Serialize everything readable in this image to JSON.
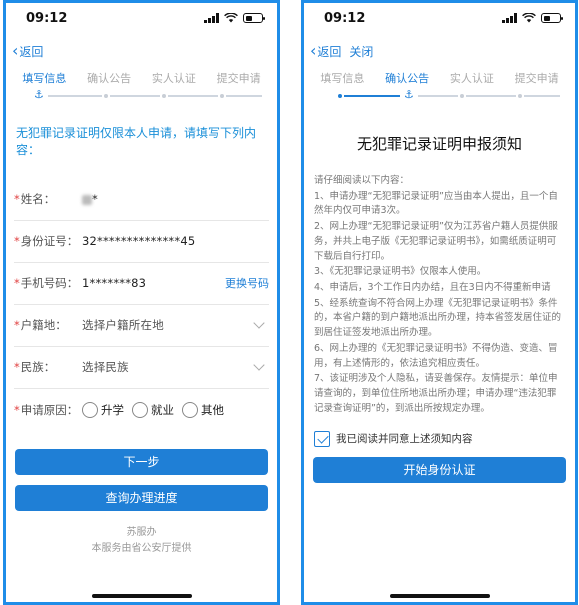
{
  "status": {
    "time": "09:12"
  },
  "left": {
    "nav": {
      "back": "返回"
    },
    "steps": [
      "填写信息",
      "确认公告",
      "实人认证",
      "提交申请"
    ],
    "intro": "无犯罪记录证明仅限本人申请，请填写下列内容：",
    "fields": {
      "name": {
        "label": "姓名：",
        "value": "*"
      },
      "id": {
        "label": "身份证号：",
        "value": "32**************45"
      },
      "phone": {
        "label": "手机号码：",
        "value": "1*******83",
        "link": "更换号码"
      },
      "huji": {
        "label": "户籍地：",
        "value": "选择户籍所在地"
      },
      "minzu": {
        "label": "民族：",
        "value": "选择民族"
      },
      "reason": {
        "label": "申请原因：",
        "options": [
          "升学",
          "就业",
          "其他"
        ]
      }
    },
    "next_button": "下一步",
    "query_button": "查询办理进度",
    "footer": {
      "line1": "苏服办",
      "line2": "本服务由省公安厅提供"
    }
  },
  "right": {
    "nav": {
      "back": "返回",
      "close": "关闭"
    },
    "steps": [
      "填写信息",
      "确认公告",
      "实人认证",
      "提交申请"
    ],
    "title": "无犯罪记录证明申报须知",
    "notice_head": "请仔细阅读以下内容：",
    "notice": [
      "1、申请办理“无犯罪记录证明”应当由本人提出，且一个自然年内仅可申请3次。",
      "2、网上办理“无犯罪记录证明”仅为江苏省户籍人员提供服务，并共上电子版《无犯罪记录证明书》，如需纸质证明可下载后自行打印。",
      "3、《无犯罪记录证明书》仅限本人使用。",
      "4、申请后，3个工作日内办结，且在3日内不得重新申请",
      "5、经系统查询不符合网上办理《无犯罪记录证明书》条件的，本省户籍的到户籍地派出所办理，持本省签发居住证的到居住证签发地派出所办理。",
      "6、网上办理的《无犯罪记录证明书》不得伪造、变造、冒用，有上述情形的，依法追究相应责任。",
      "7、该证明涉及个人隐私，请妥善保存。友情提示：单位申请查询的，到单位住所地派出所办理；申请办理“违法犯罪记录查询证明”的，到派出所按规定办理。"
    ],
    "agree": "我已阅读并同意上述须知内容",
    "start_button": "开始身份认证"
  }
}
